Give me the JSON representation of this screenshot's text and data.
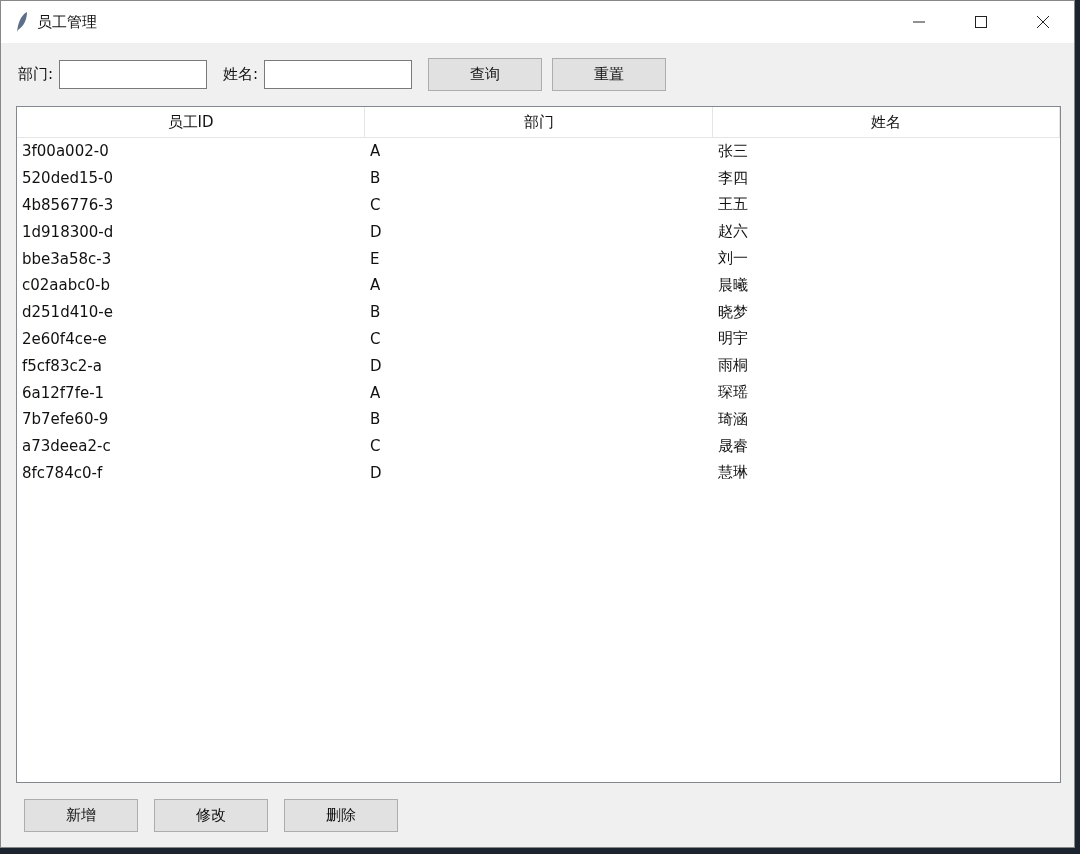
{
  "window": {
    "title": "员工管理"
  },
  "filters": [
    {
      "label": "部门:"
    },
    {
      "label": "姓名:"
    }
  ],
  "toolbar_buttons": [
    "查询",
    "重置"
  ],
  "table": {
    "columns": [
      "员工ID",
      "部门",
      "姓名"
    ],
    "rows": [
      [
        "3f00a002-0",
        "A",
        "张三"
      ],
      [
        "520ded15-0",
        "B",
        "李四"
      ],
      [
        "4b856776-3",
        "C",
        "王五"
      ],
      [
        "1d918300-d",
        "D",
        "赵六"
      ],
      [
        "bbe3a58c-3",
        "E",
        "刘一"
      ],
      [
        "c02aabc0-b",
        "A",
        "晨曦"
      ],
      [
        "d251d410-e",
        "B",
        "晓梦"
      ],
      [
        "2e60f4ce-e",
        "C",
        "明宇"
      ],
      [
        "f5cf83c2-a",
        "D",
        "雨桐"
      ],
      [
        "6a12f7fe-1",
        "A",
        "琛瑶"
      ],
      [
        "7b7efe60-9",
        "B",
        "琦涵"
      ],
      [
        "a73deea2-c",
        "C",
        "晟睿"
      ],
      [
        "8fc784c0-f",
        "D",
        "慧琳"
      ]
    ]
  },
  "bottom_buttons": [
    "新增",
    "修改",
    "删除"
  ]
}
